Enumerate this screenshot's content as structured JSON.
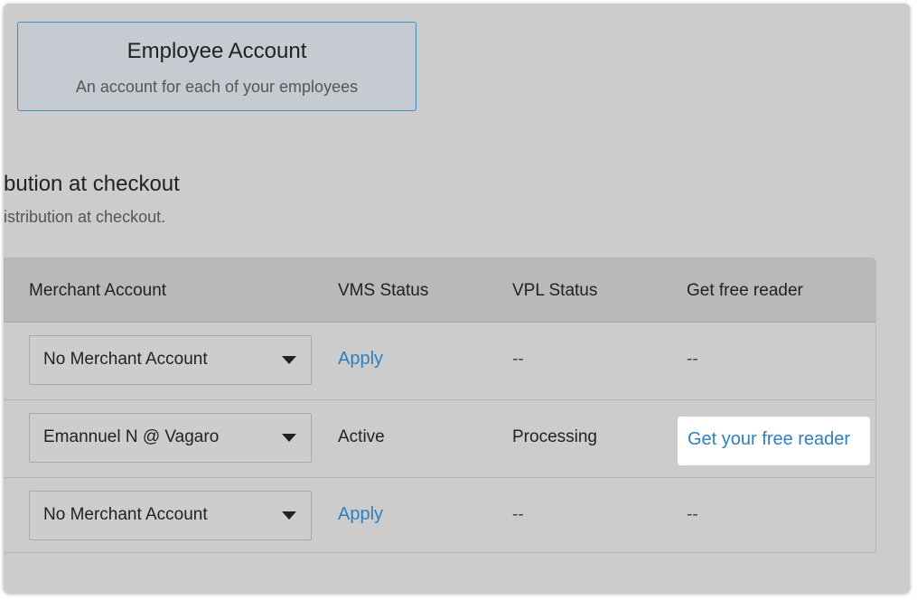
{
  "account_card": {
    "title": "Employee Account",
    "subtitle": "An account for each of your employees"
  },
  "section": {
    "heading": "bution at checkout",
    "subtext": "istribution at checkout."
  },
  "table": {
    "headers": [
      "Merchant Account",
      "VMS Status",
      "VPL Status",
      "Get free reader"
    ],
    "rows": [
      {
        "merchant": "No Merchant Account",
        "vms_status": "Apply",
        "vpl_status": "--",
        "reader": "--"
      },
      {
        "merchant": "Emannuel N @ Vagaro",
        "vms_status": "Active",
        "vpl_status": "Processing",
        "reader": "Get your free reader"
      },
      {
        "merchant": "No Merchant Account",
        "vms_status": "Apply",
        "vpl_status": "--",
        "reader": "--"
      }
    ]
  },
  "colors": {
    "link": "#2e7fc0",
    "card_border": "#3f8fc4",
    "overlay_bg": "#cccccc",
    "header_bg": "#b9b9b9",
    "highlight_bg": "#ffffff"
  },
  "icons": {
    "dropdown": "caret-down-icon"
  }
}
